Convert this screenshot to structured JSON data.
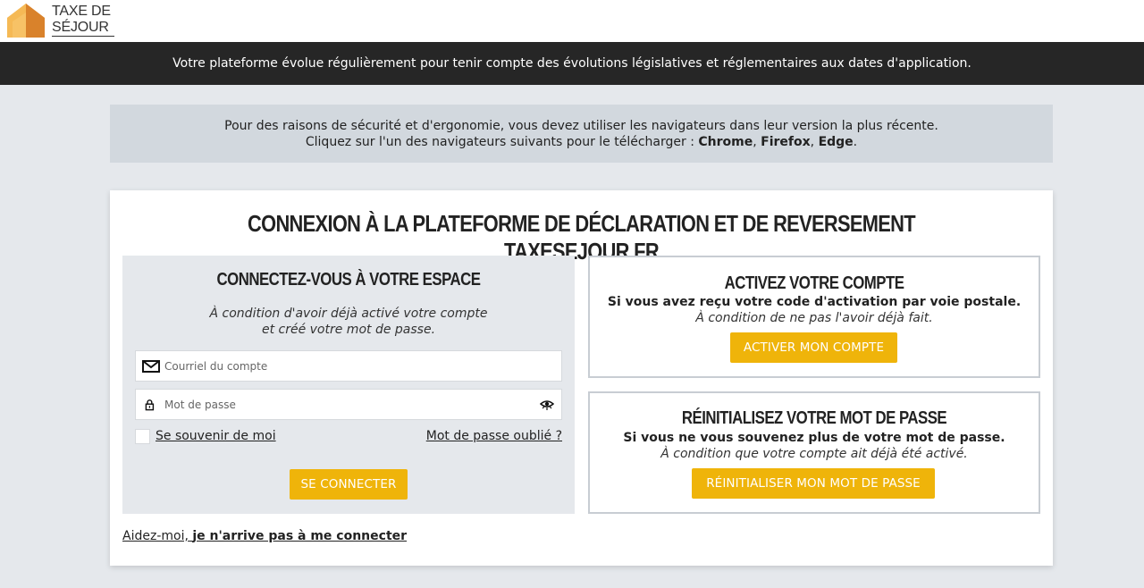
{
  "header": {
    "logo_line1": "TAXE DE",
    "logo_line2": "SÉJOUR"
  },
  "banner": {
    "text": "Votre plateforme évolue régulièrement pour tenir compte des évolutions législatives et réglementaires aux dates d'application."
  },
  "notice": {
    "line1": "Pour des raisons de sécurité et d'ergonomie, vous devez utiliser les navigateurs dans leur version la plus récente.",
    "line2_prefix": "Cliquez sur l'un des navigateurs suivants pour le télécharger : ",
    "browsers": [
      "Chrome",
      "Firefox",
      "Edge"
    ],
    "sep": ", ",
    "end": "."
  },
  "main": {
    "title": "CONNEXION À LA PLATEFORME DE DÉCLARATION ET DE REVERSEMENT TAXESEJOUR.FR"
  },
  "login": {
    "title": "CONNECTEZ-VOUS À VOTRE ESPACE",
    "sub_line1": "À condition d'avoir déjà activé votre compte",
    "sub_line2": "et créé votre mot de passe.",
    "email_placeholder": "Courriel du compte",
    "email_value": "",
    "password_placeholder": "Mot de passe",
    "password_value": "",
    "remember_label": "Se souvenir de moi",
    "remember_checked": false,
    "forgot_label": "Mot de passe oublié ?",
    "submit_label": "SE CONNECTER",
    "help_prefix": "Aidez-moi,",
    "help_link": "je n'arrive pas à me connecter"
  },
  "activate": {
    "title": "ACTIVEZ VOTRE COMPTE",
    "bold": "Si vous avez reçu votre code d'activation par voie postale.",
    "italic": "À condition de ne pas l'avoir déjà fait.",
    "button": "ACTIVER MON COMPTE"
  },
  "reset": {
    "title": "RÉINITIALISEZ VOTRE MOT DE PASSE",
    "bold": "Si vous ne vous souvenez plus de votre mot de passe.",
    "italic": "À condition que votre compte ait déjà été activé.",
    "button": "RÉINITIALISER MON MOT DE PASSE"
  },
  "colors": {
    "accent": "#efb40a",
    "banner_bg": "#262626",
    "page_bg": "#e5e8ec",
    "notice_bg": "#d2d8de",
    "logo_orange": "#e8962a"
  },
  "icons": {
    "logo": "house-logo-icon",
    "email": "envelope-icon",
    "password": "lock-icon",
    "toggle": "eye-icon"
  }
}
